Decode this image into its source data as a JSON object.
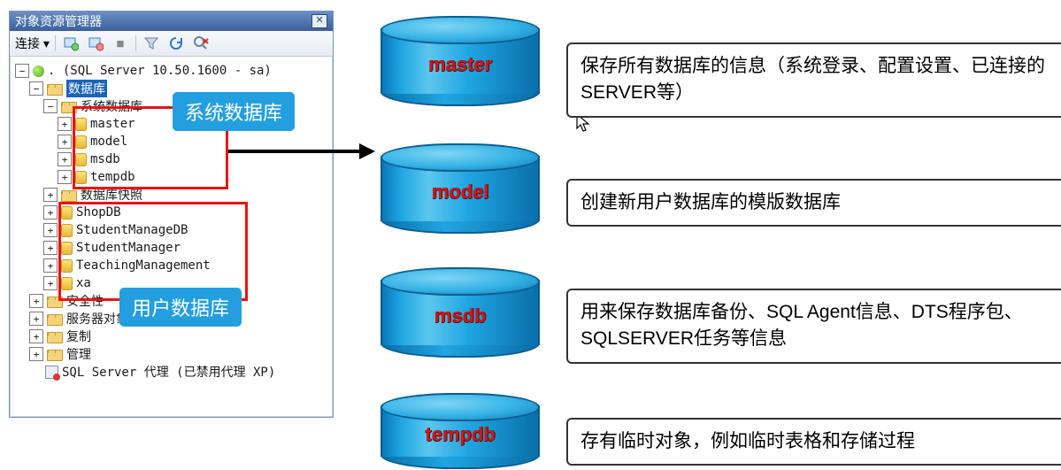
{
  "explorer": {
    "title": "对象资源管理器",
    "close": "✕",
    "toolbar": {
      "connect_label": "连接",
      "connect_dropdown": "▾"
    },
    "root": ". (SQL Server 10.50.1600 - sa)",
    "nodes": {
      "databases": "数据库",
      "system_db_folder": "系统数据库",
      "master": "master",
      "model": "model",
      "msdb": "msdb",
      "tempdb": "tempdb",
      "snapshot": "数据库快照",
      "shopdb": "ShopDB",
      "studentmanagedb": "StudentManageDB",
      "studentmanager": "StudentManager",
      "teachingmanagement": "TeachingManagement",
      "xa": "xa",
      "security": "安全性",
      "server_objects": "服务器对象",
      "replication": "复制",
      "management": "管理",
      "agent": "SQL Server 代理 (已禁用代理 XP)"
    }
  },
  "callouts": {
    "system_db": "系统数据库",
    "user_db": "用户数据库"
  },
  "cylinders": {
    "master": "master",
    "model": "model",
    "msdb": "msdb",
    "tempdb": "tempdb"
  },
  "descriptions": {
    "master": "保存所有数据库的信息（系统登录、配置设置、已连接的SERVER等）",
    "model": "创建新用户数据库的模版数据库",
    "msdb": "用来保存数据库备份、SQL Agent信息、DTS程序包、SQLSERVER任务等信息",
    "tempdb": "存有临时对象，例如临时表格和存储过程"
  }
}
